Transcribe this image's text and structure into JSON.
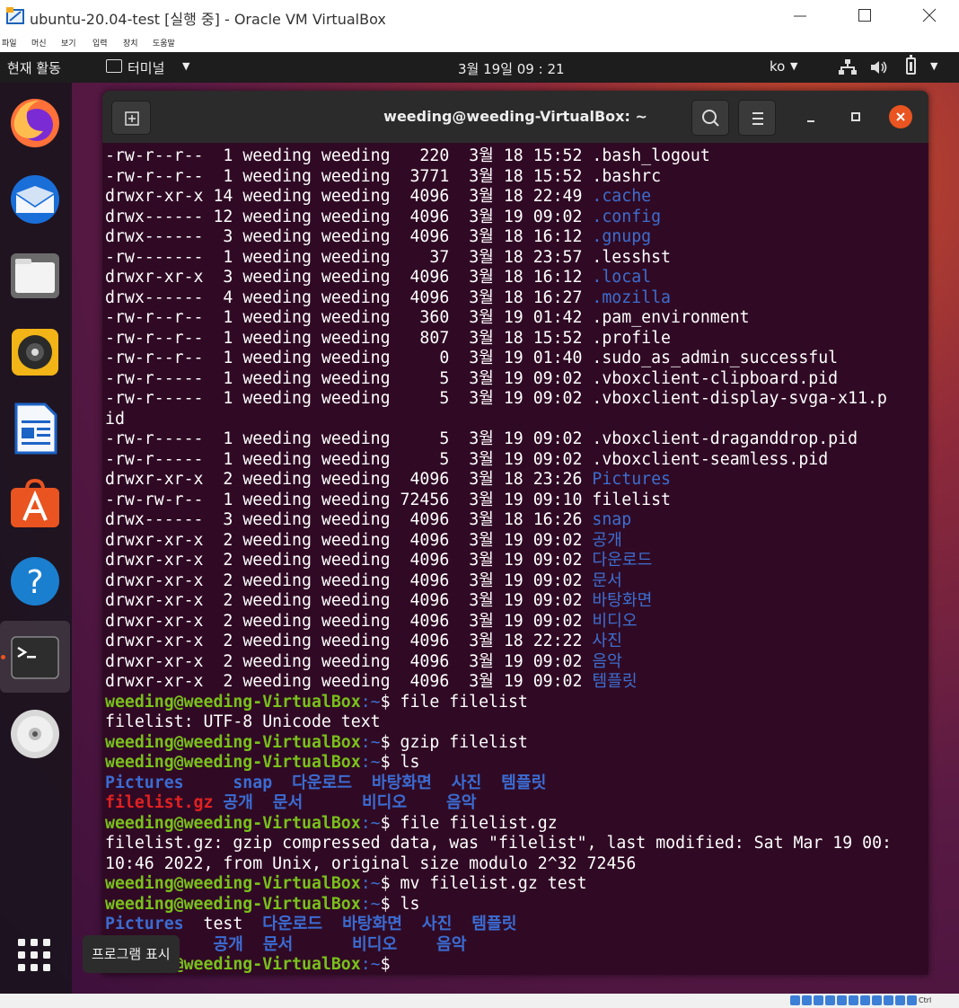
{
  "window": {
    "title": "ubuntu-20.04-test [실행 중] - Oracle VM VirtualBox",
    "menu": [
      "파일",
      "머신",
      "보기",
      "입력",
      "장치",
      "도움말"
    ]
  },
  "topbar": {
    "activities": "현재 활동",
    "app_menu": "터미널",
    "clock": "3월 19일  09 : 21",
    "language": "ko"
  },
  "dock": {
    "items": [
      "firefox-icon",
      "thunderbird-icon",
      "files-icon",
      "rhythmbox-icon",
      "libreoffice-writer-icon",
      "ubuntu-software-icon",
      "help-icon",
      "terminal-icon",
      "dvd-icon"
    ],
    "show_apps_tooltip": "프로그램 표시"
  },
  "terminal": {
    "title": "weeding@weeding-VirtualBox: ~",
    "prompt": "weeding@weeding-VirtualBox",
    "listing": [
      {
        "perm": "-rw-r--r--",
        "links": "1",
        "size": "220",
        "month": "3월",
        "day": "18",
        "time": "15:52",
        "name": ".bash_logout",
        "type": "file"
      },
      {
        "perm": "-rw-r--r--",
        "links": "1",
        "size": "3771",
        "month": "3월",
        "day": "18",
        "time": "15:52",
        "name": ".bashrc",
        "type": "file"
      },
      {
        "perm": "drwxr-xr-x",
        "links": "14",
        "size": "4096",
        "month": "3월",
        "day": "18",
        "time": "22:49",
        "name": ".cache",
        "type": "dir"
      },
      {
        "perm": "drwx------",
        "links": "12",
        "size": "4096",
        "month": "3월",
        "day": "19",
        "time": "09:02",
        "name": ".config",
        "type": "dir"
      },
      {
        "perm": "drwx------",
        "links": "3",
        "size": "4096",
        "month": "3월",
        "day": "18",
        "time": "16:12",
        "name": ".gnupg",
        "type": "dir"
      },
      {
        "perm": "-rw-------",
        "links": "1",
        "size": "37",
        "month": "3월",
        "day": "18",
        "time": "23:57",
        "name": ".lesshst",
        "type": "file"
      },
      {
        "perm": "drwxr-xr-x",
        "links": "3",
        "size": "4096",
        "month": "3월",
        "day": "18",
        "time": "16:12",
        "name": ".local",
        "type": "dir"
      },
      {
        "perm": "drwx------",
        "links": "4",
        "size": "4096",
        "month": "3월",
        "day": "18",
        "time": "16:27",
        "name": ".mozilla",
        "type": "dir"
      },
      {
        "perm": "-rw-r--r--",
        "links": "1",
        "size": "360",
        "month": "3월",
        "day": "19",
        "time": "01:42",
        "name": ".pam_environment",
        "type": "file"
      },
      {
        "perm": "-rw-r--r--",
        "links": "1",
        "size": "807",
        "month": "3월",
        "day": "18",
        "time": "15:52",
        "name": ".profile",
        "type": "file"
      },
      {
        "perm": "-rw-r--r--",
        "links": "1",
        "size": "0",
        "month": "3월",
        "day": "19",
        "time": "01:40",
        "name": ".sudo_as_admin_successful",
        "type": "file"
      },
      {
        "perm": "-rw-r-----",
        "links": "1",
        "size": "5",
        "month": "3월",
        "day": "19",
        "time": "09:02",
        "name": ".vboxclient-clipboard.pid",
        "type": "file"
      },
      {
        "perm": "-rw-r-----",
        "links": "1",
        "size": "5",
        "month": "3월",
        "day": "19",
        "time": "09:02",
        "name": ".vboxclient-display-svga-x11.p",
        "type": "file",
        "wrap": "id"
      },
      {
        "perm": "-rw-r-----",
        "links": "1",
        "size": "5",
        "month": "3월",
        "day": "19",
        "time": "09:02",
        "name": ".vboxclient-draganddrop.pid",
        "type": "file"
      },
      {
        "perm": "-rw-r-----",
        "links": "1",
        "size": "5",
        "month": "3월",
        "day": "19",
        "time": "09:02",
        "name": ".vboxclient-seamless.pid",
        "type": "file"
      },
      {
        "perm": "drwxr-xr-x",
        "links": "2",
        "size": "4096",
        "month": "3월",
        "day": "18",
        "time": "23:26",
        "name": "Pictures",
        "type": "dir"
      },
      {
        "perm": "-rw-rw-r--",
        "links": "1",
        "size": "72456",
        "month": "3월",
        "day": "19",
        "time": "09:10",
        "name": "filelist",
        "type": "file"
      },
      {
        "perm": "drwx------",
        "links": "3",
        "size": "4096",
        "month": "3월",
        "day": "18",
        "time": "16:26",
        "name": "snap",
        "type": "dir"
      },
      {
        "perm": "drwxr-xr-x",
        "links": "2",
        "size": "4096",
        "month": "3월",
        "day": "19",
        "time": "09:02",
        "name": "공개",
        "type": "dir"
      },
      {
        "perm": "drwxr-xr-x",
        "links": "2",
        "size": "4096",
        "month": "3월",
        "day": "19",
        "time": "09:02",
        "name": "다운로드",
        "type": "dir"
      },
      {
        "perm": "drwxr-xr-x",
        "links": "2",
        "size": "4096",
        "month": "3월",
        "day": "19",
        "time": "09:02",
        "name": "문서",
        "type": "dir"
      },
      {
        "perm": "drwxr-xr-x",
        "links": "2",
        "size": "4096",
        "month": "3월",
        "day": "19",
        "time": "09:02",
        "name": "바탕화면",
        "type": "dir"
      },
      {
        "perm": "drwxr-xr-x",
        "links": "2",
        "size": "4096",
        "month": "3월",
        "day": "19",
        "time": "09:02",
        "name": "비디오",
        "type": "dir"
      },
      {
        "perm": "drwxr-xr-x",
        "links": "2",
        "size": "4096",
        "month": "3월",
        "day": "18",
        "time": "22:22",
        "name": "사진",
        "type": "dir"
      },
      {
        "perm": "drwxr-xr-x",
        "links": "2",
        "size": "4096",
        "month": "3월",
        "day": "19",
        "time": "09:02",
        "name": "음악",
        "type": "dir"
      },
      {
        "perm": "drwxr-xr-x",
        "links": "2",
        "size": "4096",
        "month": "3월",
        "day": "19",
        "time": "09:02",
        "name": "템플릿",
        "type": "dir"
      }
    ],
    "session": [
      {
        "kind": "cmd",
        "text": " file filelist"
      },
      {
        "kind": "out",
        "text": "filelist: UTF-8 Unicode text"
      },
      {
        "kind": "cmd",
        "text": " gzip filelist"
      },
      {
        "kind": "cmd",
        "text": " ls"
      },
      {
        "kind": "cols",
        "segs": [
          [
            "Pictures",
            "dir"
          ],
          [
            "     ",
            "plain"
          ],
          [
            "snap",
            "dir"
          ],
          [
            "  ",
            "plain"
          ],
          [
            "다운로드",
            "dir"
          ],
          [
            "  ",
            "plain"
          ],
          [
            "바탕화면",
            "dir"
          ],
          [
            "  ",
            "plain"
          ],
          [
            "사진",
            "dir"
          ],
          [
            "  ",
            "plain"
          ],
          [
            "템플릿",
            "dir"
          ]
        ]
      },
      {
        "kind": "cols",
        "segs": [
          [
            "filelist.gz",
            "arch"
          ],
          [
            " ",
            "plain"
          ],
          [
            "공개",
            "dir"
          ],
          [
            "  ",
            "plain"
          ],
          [
            "문서",
            "dir"
          ],
          [
            "      ",
            "plain"
          ],
          [
            "비디오",
            "dir"
          ],
          [
            "    ",
            "plain"
          ],
          [
            "음악",
            "dir"
          ]
        ]
      },
      {
        "kind": "cmd",
        "text": " file filelist.gz"
      },
      {
        "kind": "out",
        "text": "filelist.gz: gzip compressed data, was \"filelist\", last modified: Sat Mar 19 00:"
      },
      {
        "kind": "out",
        "text": "10:46 2022, from Unix, original size modulo 2^32 72456"
      },
      {
        "kind": "cmd",
        "text": " mv filelist.gz test"
      },
      {
        "kind": "cmd",
        "text": " ls"
      },
      {
        "kind": "cols",
        "segs": [
          [
            "Pictures",
            "dir"
          ],
          [
            "  ",
            "plain"
          ],
          [
            "test",
            "plain"
          ],
          [
            "  ",
            "plain"
          ],
          [
            "다운로드",
            "dir"
          ],
          [
            "  ",
            "plain"
          ],
          [
            "바탕화면",
            "dir"
          ],
          [
            "  ",
            "plain"
          ],
          [
            "사진",
            "dir"
          ],
          [
            "  ",
            "plain"
          ],
          [
            "템플릿",
            "dir"
          ]
        ]
      },
      {
        "kind": "cols",
        "segs": [
          [
            "           ",
            "plain"
          ],
          [
            "공개",
            "dir"
          ],
          [
            "  ",
            "plain"
          ],
          [
            "문서",
            "dir"
          ],
          [
            "      ",
            "plain"
          ],
          [
            "비디오",
            "dir"
          ],
          [
            "    ",
            "plain"
          ],
          [
            "음악",
            "dir"
          ]
        ]
      },
      {
        "kind": "cmd",
        "text": " "
      }
    ],
    "prompt_suffix": ":~$"
  },
  "colors": {
    "terminal_bg": "#300a24",
    "prompt_green": "#79c11b",
    "dir_blue": "#3b6cd3",
    "archive_red": "#e12121",
    "ubuntu_orange": "#e95420"
  },
  "statusbar": {
    "host_key": "Ctrl"
  }
}
